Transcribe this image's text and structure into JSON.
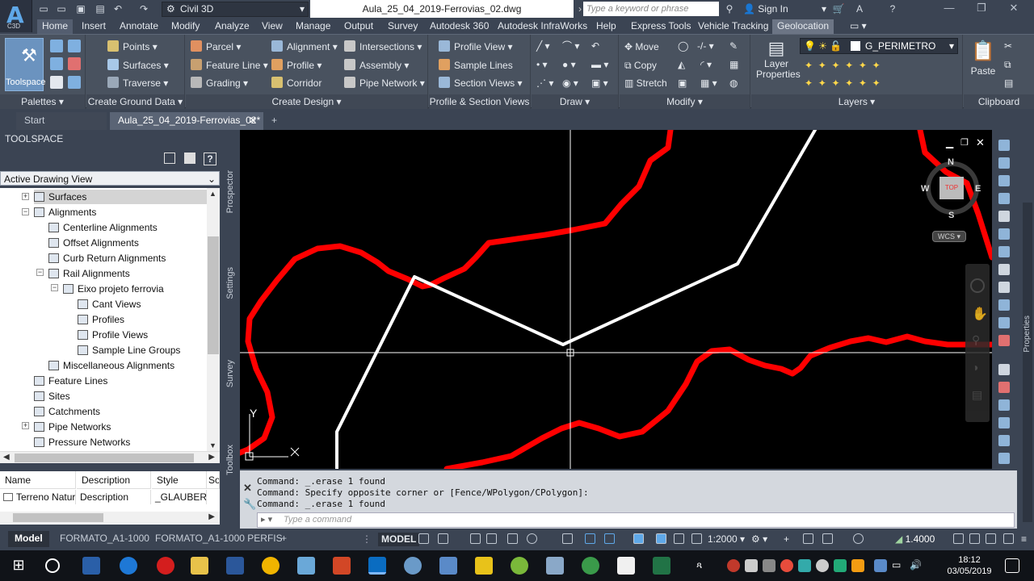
{
  "app": {
    "logo_letter": "A",
    "logo_sub": "C3D"
  },
  "titlebar": {
    "workspace": "Civil 3D",
    "document_title": "Aula_25_04_2019-Ferrovias_02.dwg",
    "search_placeholder": "Type a keyword or phrase",
    "sign_in": "Sign In"
  },
  "ribbon_tabs": [
    "Home",
    "Insert",
    "Annotate",
    "Modify",
    "Analyze",
    "View",
    "Manage",
    "Output",
    "Survey",
    "Autodesk 360",
    "Autodesk InfraWorks",
    "Help",
    "Express Tools",
    "Vehicle Tracking",
    "Geolocation"
  ],
  "ribbon": {
    "toolspace": "Toolspace",
    "palettes": "Palettes",
    "create_ground": {
      "title": "Create Ground Data",
      "items": [
        "Points",
        "Surfaces",
        "Traverse"
      ]
    },
    "create_design": {
      "title": "Create Design",
      "items": [
        "Parcel",
        "Feature Line",
        "Grading",
        "Alignment",
        "Profile",
        "Corridor",
        "Intersections",
        "Assembly",
        "Pipe Network"
      ]
    },
    "profile_section": {
      "title": "Profile & Section Views",
      "items": [
        "Profile View",
        "Sample Lines",
        "Section Views"
      ]
    },
    "draw": {
      "title": "Draw"
    },
    "modify": {
      "title": "Modify",
      "items": [
        "Move",
        "Copy",
        "Stretch"
      ]
    },
    "layers": {
      "title": "Layers",
      "layer_properties": "Layer Properties",
      "current_layer": "G_PERIMETRO"
    },
    "clipboard": {
      "title": "Clipboard",
      "paste": "Paste"
    }
  },
  "file_tabs": [
    "Start",
    "Aula_25_04_2019-Ferrovias_02*"
  ],
  "toolspace": {
    "title": "TOOLSPACE",
    "view": "Active Drawing View",
    "tree": [
      "Surfaces",
      "Alignments",
      "Centerline Alignments",
      "Offset Alignments",
      "Curb Return Alignments",
      "Rail Alignments",
      "Eixo projeto ferrovia",
      "Cant Views",
      "Profiles",
      "Profile Views",
      "Sample Line Groups",
      "Miscellaneous Alignments",
      "Feature Lines",
      "Sites",
      "Catchments",
      "Pipe Networks",
      "Pressure Networks"
    ],
    "table": {
      "columns": [
        "Name",
        "Description",
        "Style",
        "So"
      ],
      "row": [
        "Terreno Natur",
        "Description",
        "_GLAUBER_",
        ""
      ]
    },
    "side_tabs": [
      "Prospector",
      "Settings",
      "Survey",
      "Toolbox"
    ]
  },
  "viewcube": {
    "n": "N",
    "s": "S",
    "e": "E",
    "w": "W",
    "top": "TOP",
    "wcs": "WCS"
  },
  "ucs": {
    "y": "Y"
  },
  "right_panel_label": "Properties",
  "command": {
    "lines": [
      "Command: _.erase 1 found",
      "Command: Specify opposite corner or [Fence/WPolygon/CPolygon]:",
      "Command: _.erase 1 found"
    ],
    "placeholder": "Type a command"
  },
  "layout_tabs": [
    "Model",
    "FORMATO_A1-1000",
    "FORMATO_A1-1000 PERFIS"
  ],
  "status": {
    "model": "MODEL",
    "scale": "1:2000",
    "value": "1.4000"
  },
  "taskbar": {
    "time": "18:12",
    "date": "03/05/2019"
  },
  "colors": {
    "contour": "#ff0000",
    "alignment": "#ffffff",
    "crosshair": "#ffffff"
  }
}
